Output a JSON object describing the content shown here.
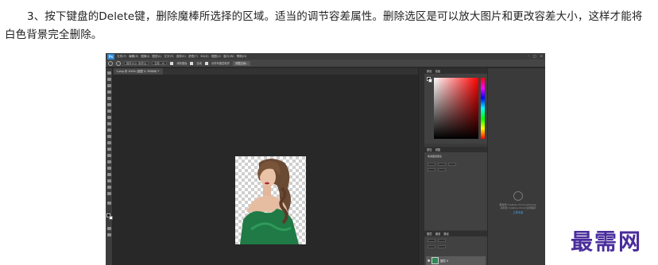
{
  "article": {
    "paragraph": "3、按下键盘的Delete键，删除魔棒所选择的区域。适当的调节容差属性。删除选区是可以放大图片和更改容差大小，这样才能将白色背景完全删除。"
  },
  "watermark": {
    "text": "最需网",
    "color": "#4a2d9c"
  },
  "photoshop": {
    "logo": "Ps",
    "menu": [
      "文件(F)",
      "编辑(E)",
      "图像(I)",
      "图层(L)",
      "文字(Y)",
      "选择(S)",
      "滤镜(T)",
      "3D(D)",
      "视图(V)",
      "窗口(W)",
      "帮助(H)"
    ],
    "window_buttons": [
      "–",
      "□",
      "×"
    ],
    "options_bar": {
      "sample_size_value": "取样大小: 取样点",
      "tolerance_value": "容差: 10",
      "antialias_label": "消除锯齿",
      "contiguous_label": "连续",
      "sample_all_label": "对所有图层取样",
      "refine_edge_button": "调整边缘..."
    },
    "document_tab": "1.png @ 100% (图层 0, RGB/8) *",
    "panels": {
      "color_tabs": [
        "颜色",
        "色板"
      ],
      "properties_tabs": [
        "属性",
        "调整"
      ],
      "properties_title": "像素图层属性",
      "layers_tabs": [
        "图层",
        "通道",
        "路径"
      ],
      "layer_name": "图层 0"
    },
    "cc_libraries": {
      "line1": "要使用 Creative Cloud Libraries,",
      "line2": "请安装 Creative Cloud 应用程序",
      "link": "立即安装"
    },
    "colors": {
      "accent_blue": "#2d89d6",
      "layer_thumb": "#2f8a55"
    }
  }
}
